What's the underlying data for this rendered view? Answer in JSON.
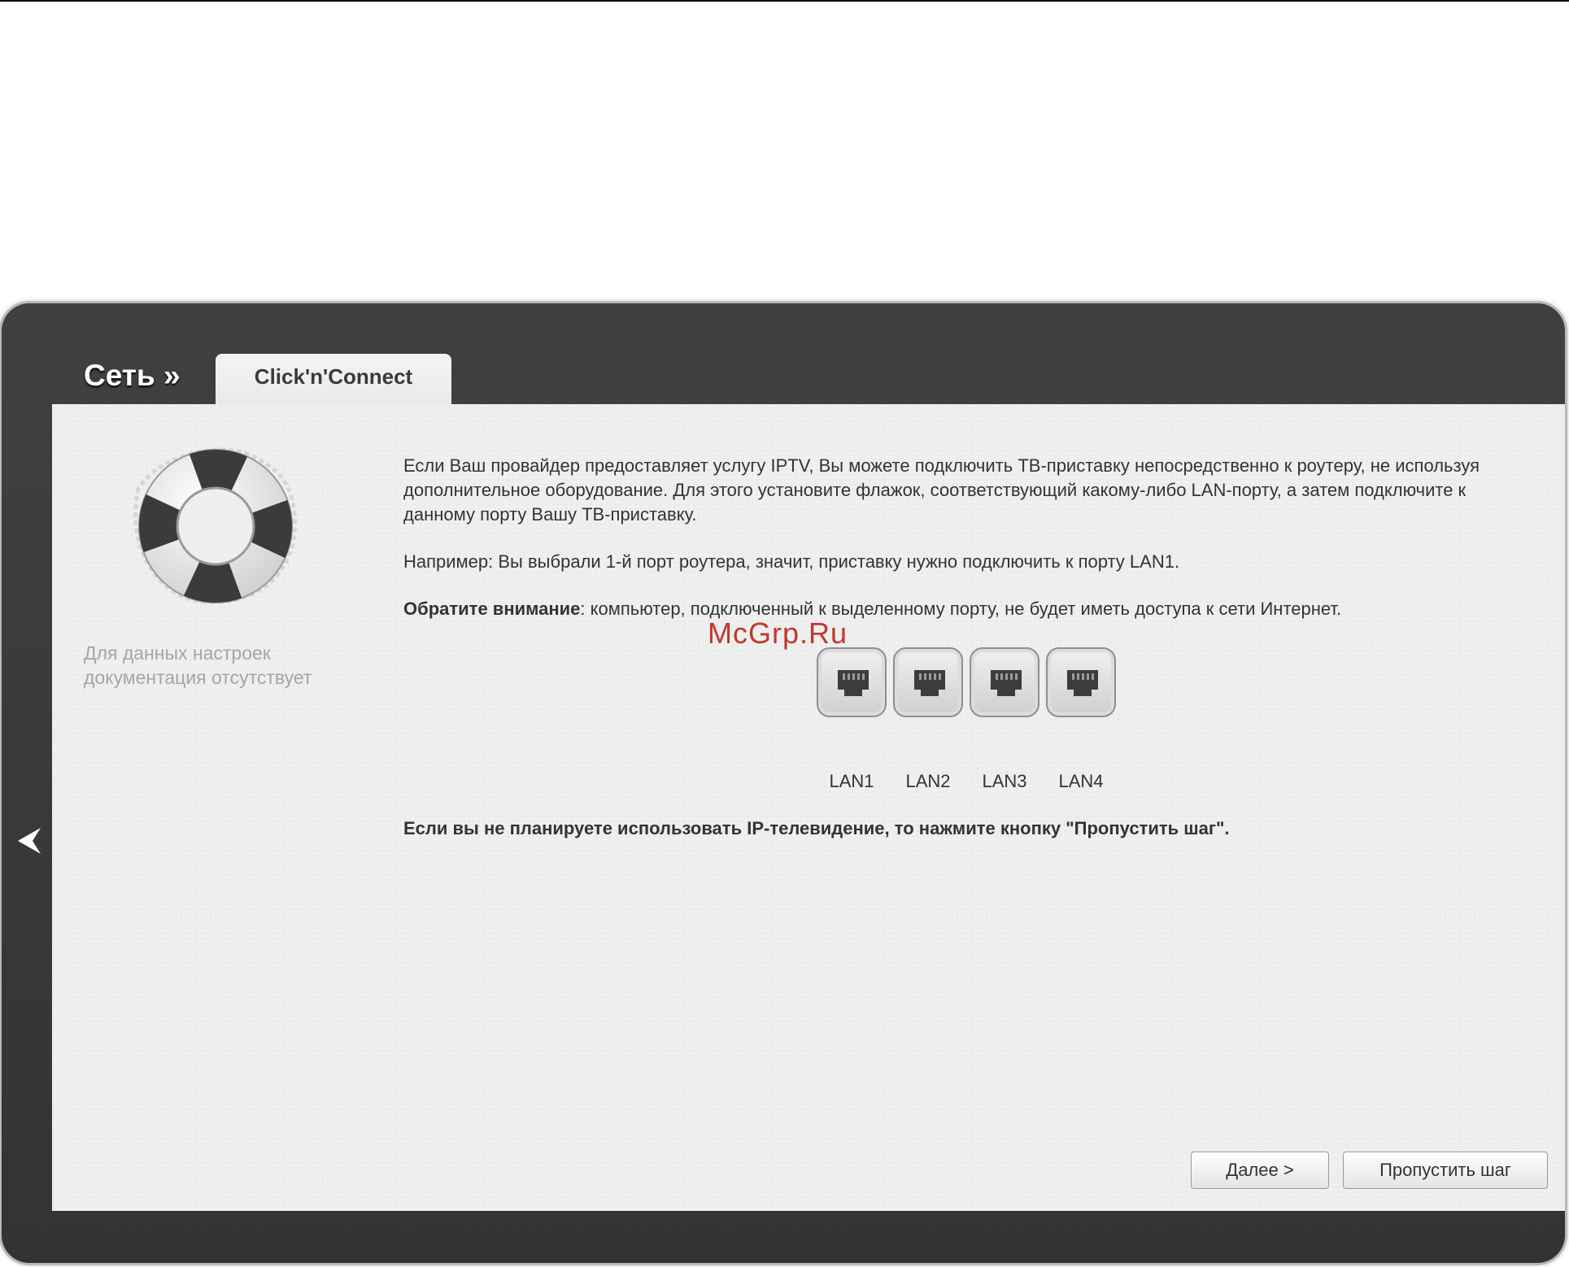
{
  "breadcrumb": {
    "section": "Сеть »"
  },
  "tab": {
    "label": "Click'n'Connect"
  },
  "sidebar": {
    "doc_note_line1": "Для данных настроек",
    "doc_note_line2": "документация отсутствует"
  },
  "content": {
    "intro": "Если Ваш провайдер предоставляет услугу IPTV, Вы можете подключить ТВ-приставку непосредственно к роутеру, не используя дополнительное оборудование. Для этого установите флажок, соответствующий какому-либо LAN-порту, а затем подключите к данному порту Вашу ТВ-приставку.",
    "example": "Например: Вы выбрали 1-й порт роутера, значит, приставку нужно подключить к порту LAN1.",
    "attention_label": "Обратите внимание",
    "attention_text": ": компьютер, подключенный к выделенному порту, не будет иметь доступа к сети Интернет.",
    "skip_notice": "Если вы не планируете использовать IP-телевидение, то нажмите кнопку \"Пропустить шаг\"."
  },
  "watermark": "McGrp.Ru",
  "ports": [
    {
      "label": "LAN1"
    },
    {
      "label": "LAN2"
    },
    {
      "label": "LAN3"
    },
    {
      "label": "LAN4"
    }
  ],
  "buttons": {
    "next": "Далее >",
    "skip": "Пропустить шаг"
  },
  "icons": {
    "back": "chevron-left-icon",
    "help": "lifebuoy-icon",
    "port": "ethernet-port-icon"
  },
  "colors": {
    "frame": "#3a3a3a",
    "panel": "#efefef",
    "watermark": "#c0392b"
  }
}
